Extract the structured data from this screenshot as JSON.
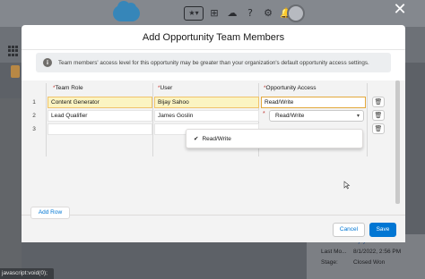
{
  "modal": {
    "title": "Add Opportunity Team Members",
    "info": "Team members' access level for this opportunity may be greater than your organization's default opportunity access settings."
  },
  "table": {
    "headers": {
      "required_mark": "*",
      "team_role": "Team Role",
      "user": "User",
      "access": "Opportunity Access"
    },
    "rows": [
      {
        "num": "1",
        "role": "Content Generator",
        "user": "Bijay Sahoo",
        "access": "Read/Write"
      },
      {
        "num": "2",
        "role": "Lead Qualifier",
        "user": "James Goslin",
        "access": "Read/Write"
      },
      {
        "num": "3",
        "role": "",
        "user": "",
        "access": ""
      }
    ]
  },
  "dropdown": {
    "options": [
      {
        "label": "Read/Write",
        "selected": true
      }
    ]
  },
  "buttons": {
    "add_row": "Add Row",
    "cancel": "Cancel",
    "save": "Save"
  },
  "background": {
    "detail_rows": [
      {
        "label": "Last Mo...",
        "value": "Bijay Sahoo"
      },
      {
        "label": "Last Mo...",
        "value": "8/1/2022, 2:56 PM"
      },
      {
        "label": "Stage:",
        "value": "Closed Won"
      }
    ],
    "status_bar": "javascript:void(0);"
  },
  "icons": {
    "close": "close-icon",
    "info": "info-icon",
    "delete": "trash-icon",
    "checkmark": "check-icon",
    "dropdown": "chevron-down-icon"
  },
  "colors": {
    "brand": "#0176d3",
    "highlight": "#fbf4c2",
    "highlight_border": "#f0c36b",
    "required": "#c23934"
  }
}
